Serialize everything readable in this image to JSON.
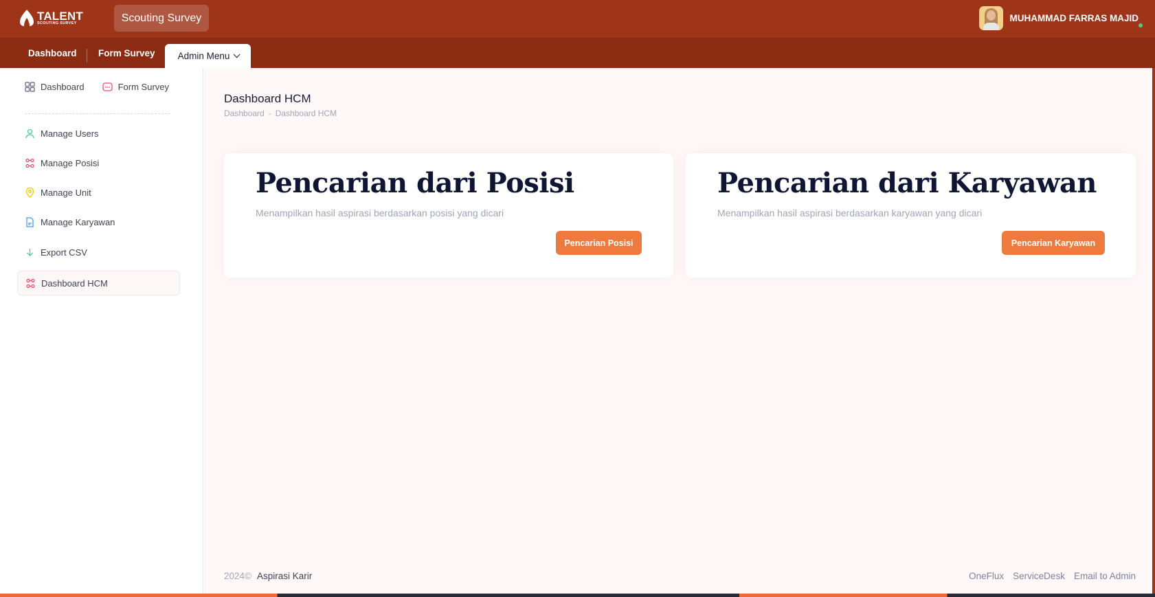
{
  "header": {
    "logo_title": "TALENT",
    "logo_subtitle": "SCOUTING SURVEY",
    "app_name": "Scouting Survey",
    "user_name": "MUHAMMAD FARRAS MAJID"
  },
  "nav": {
    "dashboard": "Dashboard",
    "form_survey": "Form Survey",
    "admin_menu": "Admin Menu"
  },
  "sidebar": {
    "top_links": [
      {
        "label": "Dashboard",
        "icon": "grid-icon"
      },
      {
        "label": "Form Survey",
        "icon": "survey-icon"
      }
    ],
    "items": [
      {
        "label": "Manage Users",
        "icon": "user-icon",
        "color": "#50cd89"
      },
      {
        "label": "Manage Posisi",
        "icon": "network-icon",
        "color": "#f1416c"
      },
      {
        "label": "Manage Unit",
        "icon": "location-pin-icon",
        "color": "#ffc700"
      },
      {
        "label": "Manage Karyawan",
        "icon": "document-icon",
        "color": "#3e97ff"
      },
      {
        "label": "Export CSV",
        "icon": "arrow-down-icon",
        "color": "#50cd89"
      },
      {
        "label": "Dashboard HCM",
        "icon": "network-icon",
        "color": "#f1416c",
        "active": true
      }
    ]
  },
  "page": {
    "title": "Dashboard HCM",
    "breadcrumb": [
      "Dashboard",
      "Dashboard HCM"
    ],
    "breadcrumb_sep": "-"
  },
  "cards": [
    {
      "title": "Pencarian dari Posisi",
      "description": "Menampilkan hasil aspirasi berdasarkan posisi yang dicari",
      "button": "Pencarian Posisi"
    },
    {
      "title": "Pencarian dari Karyawan",
      "description": "Menampilkan hasil aspirasi berdasarkan karyawan yang dicari",
      "button": "Pencarian Karyawan"
    }
  ],
  "footer": {
    "year": "2024©",
    "brand": "Aspirasi Karir",
    "links": [
      "OneFlux",
      "ServiceDesk",
      "Email to Admin"
    ]
  },
  "colors": {
    "header": "#9e3418",
    "navbar": "#8b2c12",
    "accent_button": "#ee7b3d"
  }
}
